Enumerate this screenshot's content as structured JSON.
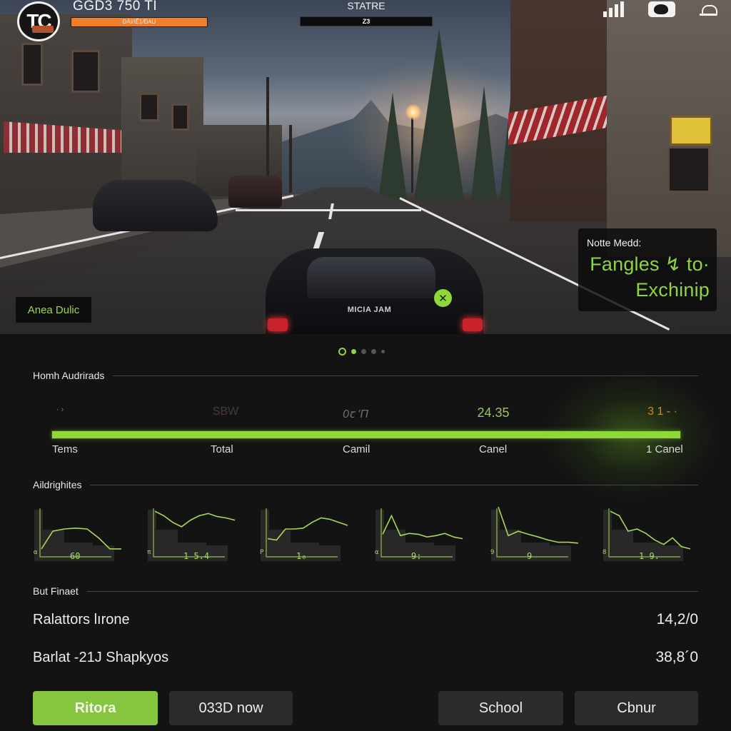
{
  "hud": {
    "logo_text": "TC",
    "title": "GGD3 750 TI",
    "progress_label": "ĐÀI/IẾ1/ĐAU",
    "state_title": "STATRE",
    "state_value": "Z3",
    "icons": [
      "signal-icon",
      "gamepad-icon",
      "bell-icon"
    ]
  },
  "scene": {
    "area_label": "Anea Dulic",
    "car_badge": "MICIA JAM",
    "notice": {
      "title": "Notte Medd:",
      "body_line1": "Fangles ↯ to·",
      "body_line2": "Exchinip"
    },
    "marker_glyph": "✕"
  },
  "carousel": {
    "count": 5,
    "active": 0
  },
  "summary": {
    "title": "Homh Audrirads",
    "progress": 1.0,
    "accent": "#8fd83a",
    "top_values": [
      {
        "text": "· ›",
        "color": "#777777"
      },
      {
        "text": "SBW",
        "color": "#4a3a36"
      },
      {
        "text": "0ꞇ 'Π",
        "color": "#707070"
      },
      {
        "text": "24.35",
        "color": "#9cc45c"
      },
      {
        "text": "3 1 - ·",
        "color": "#d08a2e"
      }
    ],
    "labels": [
      "Tems",
      "Total",
      "Camil",
      "Canel",
      "1 Canel"
    ]
  },
  "highlights": {
    "title": "Aildrighites",
    "charts": [
      {
        "label": "60",
        "axis": "α",
        "points": [
          0.95,
          0.55,
          0.5,
          0.48,
          0.5,
          0.7,
          0.95,
          0.95
        ]
      },
      {
        "label": "1 5.4",
        "axis": "π",
        "points": [
          0.1,
          0.2,
          0.35,
          0.45,
          0.3,
          0.2,
          0.15,
          0.22,
          0.25,
          0.3
        ]
      },
      {
        "label": "1₀",
        "axis": "P",
        "points": [
          0.72,
          0.75,
          0.5,
          0.5,
          0.48,
          0.35,
          0.25,
          0.28,
          0.35,
          0.42
        ]
      },
      {
        "label": "9:",
        "axis": "α",
        "points": [
          0.62,
          0.2,
          0.65,
          0.6,
          0.62,
          0.68,
          0.65,
          0.6,
          0.68,
          0.72
        ]
      },
      {
        "label": "9",
        "axis": "9",
        "points": [
          0.0,
          0.65,
          0.55,
          0.62,
          0.68,
          0.75,
          0.8,
          0.8,
          0.82
        ]
      },
      {
        "label": "1 9.",
        "axis": "8",
        "points": [
          0.1,
          0.2,
          0.55,
          0.5,
          0.6,
          0.75,
          0.85,
          0.7,
          0.9,
          0.95
        ]
      }
    ]
  },
  "details": {
    "title": "But Finaet",
    "rows": [
      {
        "key": "Ralattors lırone",
        "value": "14,2/0"
      },
      {
        "key": "Barlat -21J Shapkyos",
        "value": "38,8´0"
      }
    ]
  },
  "buttons": {
    "primary": "Ritoɾa",
    "secondary": "033D now",
    "school": "School",
    "cbnur": "Cbnur"
  }
}
